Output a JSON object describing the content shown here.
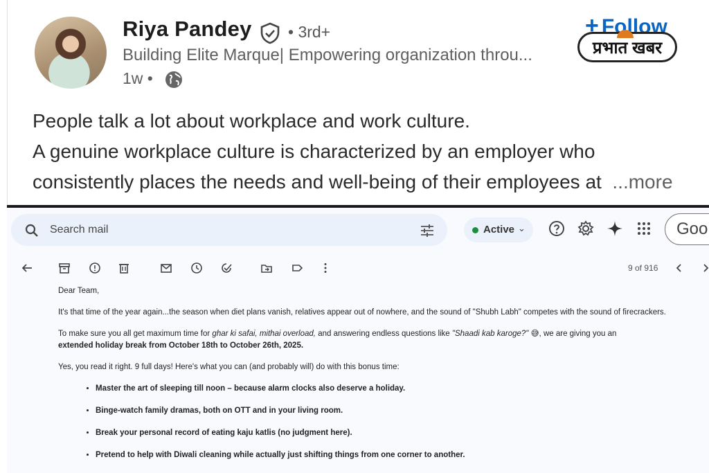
{
  "post": {
    "author": "Riya Pandey",
    "degree": "• 3rd+",
    "headline": "Building Elite Marque| Empowering organization throu...",
    "time": "1w •",
    "follow_label": "Follow",
    "follow_plus": "+",
    "text_lines": [
      "People talk a lot about workplace and work culture.",
      "A genuine workplace culture is characterized by an employer who",
      "consistently places the needs and well-being of their employees at"
    ],
    "more_label": "...more"
  },
  "watermark": {
    "text": "प्रभात खबर"
  },
  "gmail": {
    "search_placeholder": "Search mail",
    "status_label": "Active",
    "status_caret": "⌄",
    "account_label": "Goo",
    "page_count": "9 of 916",
    "greeting": "Dear Team,",
    "para1": "It's that time of the year again...the season when diet plans vanish, relatives appear out of nowhere, and the sound of \"Shubh Labh\" competes with the sound of firecrackers.",
    "para2_a": "To make sure you all get maximum time for ",
    "para2_i1": "ghar ki safai, mithai overload,",
    "para2_b": " and answering endless questions like ",
    "para2_i2": "\"Shaadi kab karoge?\"",
    "para2_c": " 😅, we are giving you an",
    "para2_bold": "extended holiday break from October 18th to October 26th, 2025.",
    "para3": "Yes, you read it right. 9 full days! Here's what you can (and probably will) do with this bonus time:",
    "bullets": [
      "Master the art of sleeping till noon – because alarm clocks also deserve a holiday.",
      "Binge-watch family dramas, both on OTT and in your living room.",
      "Break your personal record of eating kaju katlis (no judgment here).",
      "Pretend to help with Diwali cleaning while actually just shifting things from one corner to another."
    ]
  },
  "colors": {
    "follow": "#0a66c2",
    "active_dot": "#1e8e3e",
    "search_bg": "#eaf1fb"
  }
}
